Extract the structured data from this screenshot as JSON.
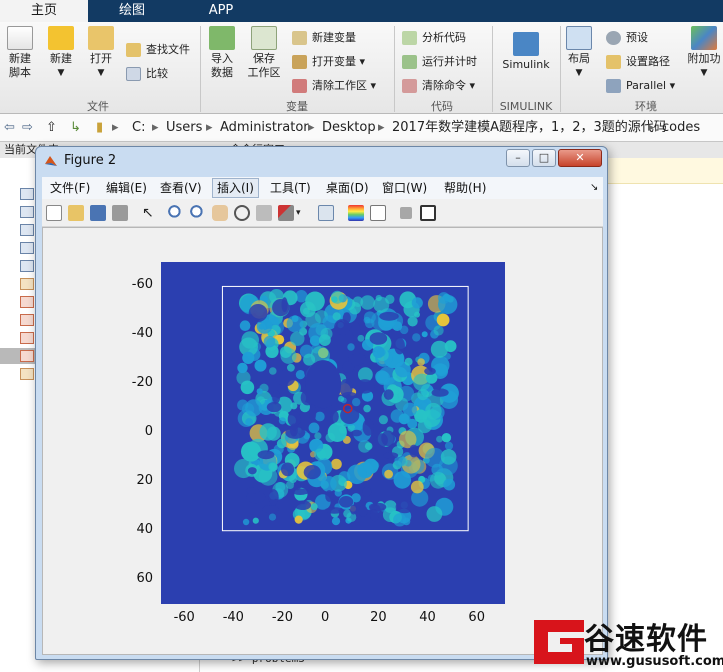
{
  "tabs": [
    "主页",
    "绘图",
    "APP"
  ],
  "ribbon": {
    "file": {
      "new_script": "新建\n脚本",
      "new": "新建",
      "open": "打开",
      "find_files": "查找文件",
      "compare": "比较",
      "group_label": "文件"
    },
    "variable": {
      "import": "导入\n数据",
      "save_ws": "保存\n工作区",
      "new_var": "新建变量",
      "open_var": "打开变量",
      "clear_ws": "清除工作区",
      "group_label": "变量"
    },
    "code": {
      "analyze": "分析代码",
      "run_time": "运行并计时",
      "clear_cmds": "清除命令",
      "group_label": "代码"
    },
    "simulink": {
      "label": "Simulink",
      "group_label": "SIMULINK"
    },
    "env": {
      "layout": "布局",
      "prefs": "预设",
      "set_path": "设置路径",
      "parallel": "Parallel",
      "addons": "附加功",
      "group_label": "环境"
    }
  },
  "address": {
    "parts": [
      "C:",
      "Users",
      "Administrator",
      "Desktop",
      "2017年数学建模A题程序，1，2，3题的源代码",
      "codes"
    ]
  },
  "left_panel": {
    "header": "当前文件夹"
  },
  "command_window": {
    "header": "命令行窗口",
    "prompt": ">> problem3"
  },
  "figure": {
    "title": "Figure 2",
    "menus": [
      "文件(F)",
      "编辑(E)",
      "查看(V)",
      "插入(I)",
      "工具(T)",
      "桌面(D)",
      "窗口(W)",
      "帮助(H)"
    ],
    "x_ticks": [
      "-60",
      "-40",
      "-20",
      "0",
      "20",
      "40",
      "60"
    ],
    "y_ticks": [
      "-60",
      "-40",
      "-20",
      "0",
      "20",
      "40",
      "60"
    ]
  },
  "chart_data": {
    "type": "heatmap",
    "xlim": [
      -70,
      70
    ],
    "ylim": [
      -70,
      70
    ],
    "x_ticks": [
      -60,
      -40,
      -20,
      0,
      20,
      40,
      60
    ],
    "y_ticks": [
      -60,
      -40,
      -20,
      0,
      20,
      40,
      60
    ],
    "y_direction": "reversed",
    "colormap": "parula",
    "frame_rect": {
      "x": [
        -45,
        55
      ],
      "y": [
        -60,
        40
      ]
    },
    "marker": {
      "x": 6,
      "y": -10
    },
    "colors": {
      "background": "#2b3fb0",
      "mid": "#1f9fd6",
      "high": "#e8c53a"
    }
  },
  "watermark": {
    "brand": "谷速软件",
    "url": "www.gususoft.com"
  }
}
